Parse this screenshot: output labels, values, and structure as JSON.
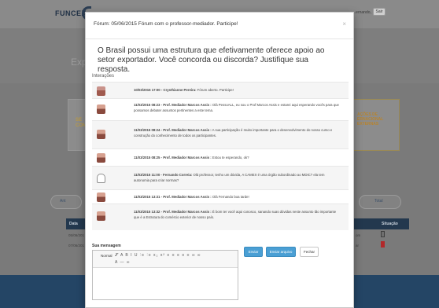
{
  "background": {
    "logo": "FUNCEX",
    "user_text": "...ernando,",
    "logout_label": "Sair",
    "hero_lines": [
      "C",
      "Exp"
    ],
    "card_left_lines": [
      "SE",
      "CON"
    ],
    "card_right_lines": [
      "AÇÕES DE",
      "ERNACIONAL",
      "EXTERNAS"
    ],
    "pill_left_label": "Ant",
    "pill_right_label": "Total",
    "table_header_left": "Data",
    "table_header_right": "Situação",
    "table_rows_left": [
      "05/06/201",
      "07/06/201"
    ],
    "table_rows_mid": [
      "om",
      "ar"
    ]
  },
  "modal": {
    "title": "Fórum: 05/06/2015 Fórum com o professor-mediador. Participe!",
    "close_symbol": "×",
    "question": "O Brasil possui uma estrutura que efetivamente oferece apoio ao setor exportador. Você concorda ou discorda? Justifique sua resposta.",
    "interactions_heading": "Interações",
    "interactions": [
      {
        "avatar": "avatar-photo",
        "author": "10/03/2015 17:00 - Crysthianne Pereira:",
        "text": " Fórum aberto. Participe!"
      },
      {
        "avatar": "avatar-photo",
        "author": "11/03/2015 08:23 - Prof. Mediador Marcos Assis :",
        "text": " Olá PessoALL, eu sou o Prof Marcos Assis e estarei aqui esperando vocês para que possamos debater assuntos pertinentes a este tema."
      },
      {
        "avatar": "avatar-photo",
        "author": "11/03/2015 08:24 - Prof. Mediador Marcos Assis :",
        "text": " A sua participação é muito importante para o desenvolvimento do nosso curso e construção do conhecimento de todos os participantes."
      },
      {
        "avatar": "avatar-photo",
        "author": "11/03/2015 08:25 - Prof. Mediador Marcos Assis :",
        "text": " Estou te esperando, ok?"
      },
      {
        "avatar": "avatar-blank",
        "author": "11/03/2015 11:00 - Fernando Correia:",
        "text": " Olá professor, tenho um dúvida, A CAMEX é uma órgão subordinado ao MDIC? ela tem autonomia para criar normas?"
      },
      {
        "avatar": "avatar-photo",
        "author": "11/03/2015 13:31 - Prof. Mediador Marcos Assis :",
        "text": " Olá Fernando boa tarde!"
      },
      {
        "avatar": "avatar-photo",
        "author": "11/03/2015 13:32 - Prof. Mediador Marcos Assis :",
        "text": " É bom ter você aqui conosco, sanando suas dúvidas neste assunto tão importante que é a Estrutura do comércio exterior de nosso país."
      }
    ],
    "message_label": "Sua mensagem",
    "editor": {
      "format_label": "Normal",
      "toolbar_row1": "𝒮 A B I U ⋮≡ ⋮≡ x₂ x² ≡ ≡ ≡ ≡ ≡ ∞ ∞",
      "toolbar_row2": "A — ∞"
    },
    "buttons": {
      "send": "Enviar",
      "send_file": "Enviar arquivo",
      "close": "Fechar"
    }
  }
}
